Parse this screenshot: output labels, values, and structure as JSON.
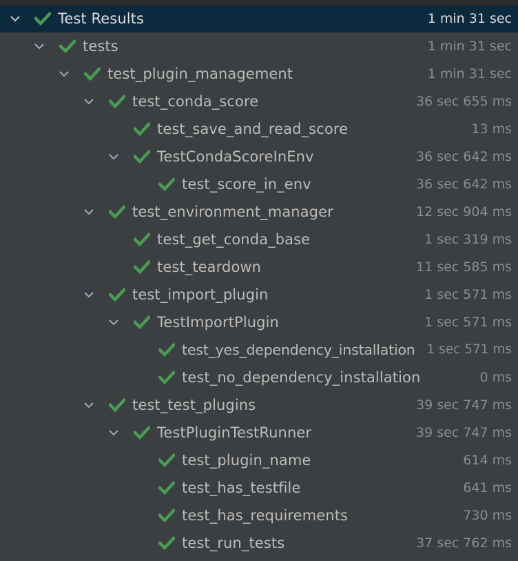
{
  "tree": {
    "root": {
      "label": "Test Results",
      "duration": "1 min 31 sec"
    },
    "tests": {
      "label": "tests",
      "duration": "1 min 31 sec"
    },
    "plugin_management": {
      "label": "test_plugin_management",
      "duration": "1 min 31 sec"
    },
    "conda_score": {
      "label": "test_conda_score",
      "duration": "36 sec 655 ms"
    },
    "save_and_read_score": {
      "label": "test_save_and_read_score",
      "duration": "13 ms"
    },
    "conda_score_in_env": {
      "label": "TestCondaScoreInEnv",
      "duration": "36 sec 642 ms"
    },
    "score_in_env": {
      "label": "test_score_in_env",
      "duration": "36 sec 642 ms"
    },
    "environment_manager": {
      "label": "test_environment_manager",
      "duration": "12 sec 904 ms"
    },
    "get_conda_base": {
      "label": "test_get_conda_base",
      "duration": "1 sec 319 ms"
    },
    "teardown": {
      "label": "test_teardown",
      "duration": "11 sec 585 ms"
    },
    "import_plugin": {
      "label": "test_import_plugin",
      "duration": "1 sec 571 ms"
    },
    "import_plugin_class": {
      "label": "TestImportPlugin",
      "duration": "1 sec 571 ms"
    },
    "yes_dependency": {
      "label": "test_yes_dependency_installation",
      "duration": "1 sec 571 ms"
    },
    "no_dependency": {
      "label": "test_no_dependency_installation",
      "duration": "0 ms"
    },
    "test_plugins": {
      "label": "test_test_plugins",
      "duration": "39 sec 747 ms"
    },
    "plugin_test_runner": {
      "label": "TestPluginTestRunner",
      "duration": "39 sec 747 ms"
    },
    "plugin_name": {
      "label": "test_plugin_name",
      "duration": "614 ms"
    },
    "has_testfile": {
      "label": "test_has_testfile",
      "duration": "641 ms"
    },
    "has_requirements": {
      "label": "test_has_requirements",
      "duration": "730 ms"
    },
    "run_tests": {
      "label": "test_run_tests",
      "duration": "37 sec 762 ms"
    }
  },
  "colors": {
    "background": "#3c3f41",
    "selected": "#0d293e",
    "check": "#499c54",
    "text": "#bbbbbb",
    "duration": "#8a8c8e"
  },
  "icons": {
    "expand": "chevron-down-icon",
    "passed": "check-icon"
  }
}
